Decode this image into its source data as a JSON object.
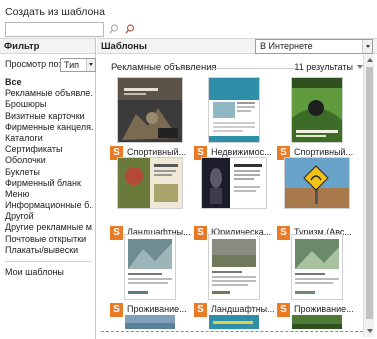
{
  "dialog": {
    "title": "Создать из шаблона"
  },
  "search": {
    "value": ""
  },
  "filter": {
    "header": "Фильтр",
    "view_by_label": "Просмотр по:",
    "view_by_value": "Тип",
    "categories": [
      "Все",
      "Рекламные объявле...",
      "Брошюры",
      "Визитные карточки",
      "Фирменные канцеля...",
      "Каталоги",
      "Сертификаты",
      "Оболочки",
      "Буклеты",
      "Фирменный бланк",
      "Меню",
      "Информационные б...",
      "Другой",
      "Другие рекламные м...",
      "Почтовые открытки",
      "Плакаты/вывески"
    ],
    "my_templates": "Мои шаблоны"
  },
  "templates": {
    "header": "Шаблоны",
    "source_value": "В Интернете",
    "section_title": "Рекламные объявления",
    "results": "11 результаты",
    "items": [
      "Спортивный...",
      "Недвижимос...",
      "Спортивный...",
      "Ландшафтны...",
      "Юридическа...",
      "Туризм (Авс...",
      "Проживание...",
      "Ландшафтны...",
      "Проживание..."
    ],
    "app_icon_letter": "S"
  },
  "colors": {
    "accent_orange": "#e97a26",
    "header_bg": "#f3f3f3"
  }
}
